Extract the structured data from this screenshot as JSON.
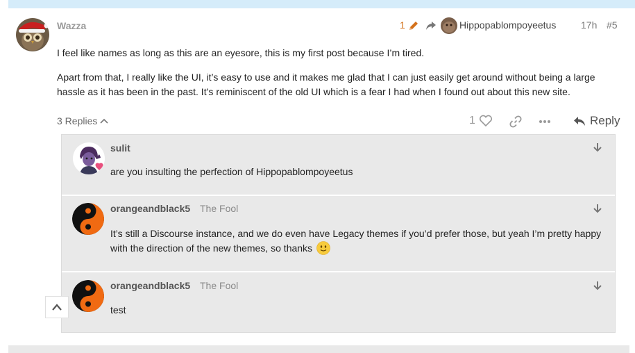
{
  "post": {
    "username": "Wazza",
    "edit_count": "1",
    "reply_to_user": "Hippopablompoyeetus",
    "time": "17h",
    "number": "#5",
    "paragraphs": [
      "I feel like names as long as this are an eyesore, this is my first post because I’m tired.",
      "Apart from that, I really like the UI, it’s easy to use and it makes me glad that I can just easily get around without being a large hassle as it has been in the past. It’s reminiscent of the old UI which is a fear I had when I found out about this new site."
    ],
    "replies_label": "3 Replies",
    "like_count": "1",
    "reply_label": "Reply"
  },
  "replies": [
    {
      "username": "sulit",
      "title": "",
      "text": "are you insulting the perfection of Hippopablompoyeetus"
    },
    {
      "username": "orangeandblack5",
      "title": "The Fool",
      "text": "It’s still a Discourse instance, and we do even have Legacy themes if you’d prefer those, but yeah I’m pretty happy with the direction of the new themes, so thanks"
    },
    {
      "username": "orangeandblack5",
      "title": "The Fool",
      "text": "test"
    }
  ],
  "icons": {
    "edit": "pencil-icon",
    "reply_to": "share-arrow-icon",
    "like": "heart-icon",
    "link": "link-icon",
    "more": "ellipsis-icon",
    "reply": "reply-icon",
    "expand": "arrow-down-icon",
    "collapse": "chevron-up-icon",
    "emoji": "slight-smile-emoji"
  },
  "colors": {
    "accent_orange": "#d4711a",
    "thread_bg": "#e9e9e9",
    "topbar": "#d5ecfa"
  }
}
